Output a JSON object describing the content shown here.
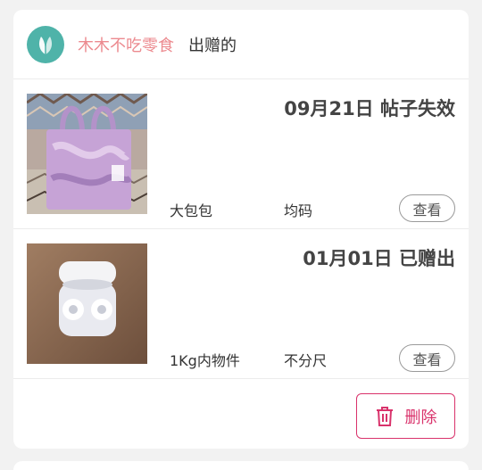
{
  "header": {
    "user_name": "木木不吃零食",
    "suffix": "出赠的"
  },
  "items": [
    {
      "status": "09月21日 帖子失效",
      "name": "大包包",
      "size": "均码",
      "view_label": "查看",
      "image_icon": "purple-bag-photo"
    },
    {
      "status": "01月01日 已赠出",
      "name": "1Kg内物件",
      "size": "不分尺",
      "view_label": "查看",
      "image_icon": "earbuds-photo"
    }
  ],
  "footer": {
    "delete_label": "删除",
    "delete_icon": "trash-icon"
  },
  "colors": {
    "accent": "#d9326b",
    "user_name": "#ec8a8f",
    "avatar": "#4fb3a9"
  }
}
